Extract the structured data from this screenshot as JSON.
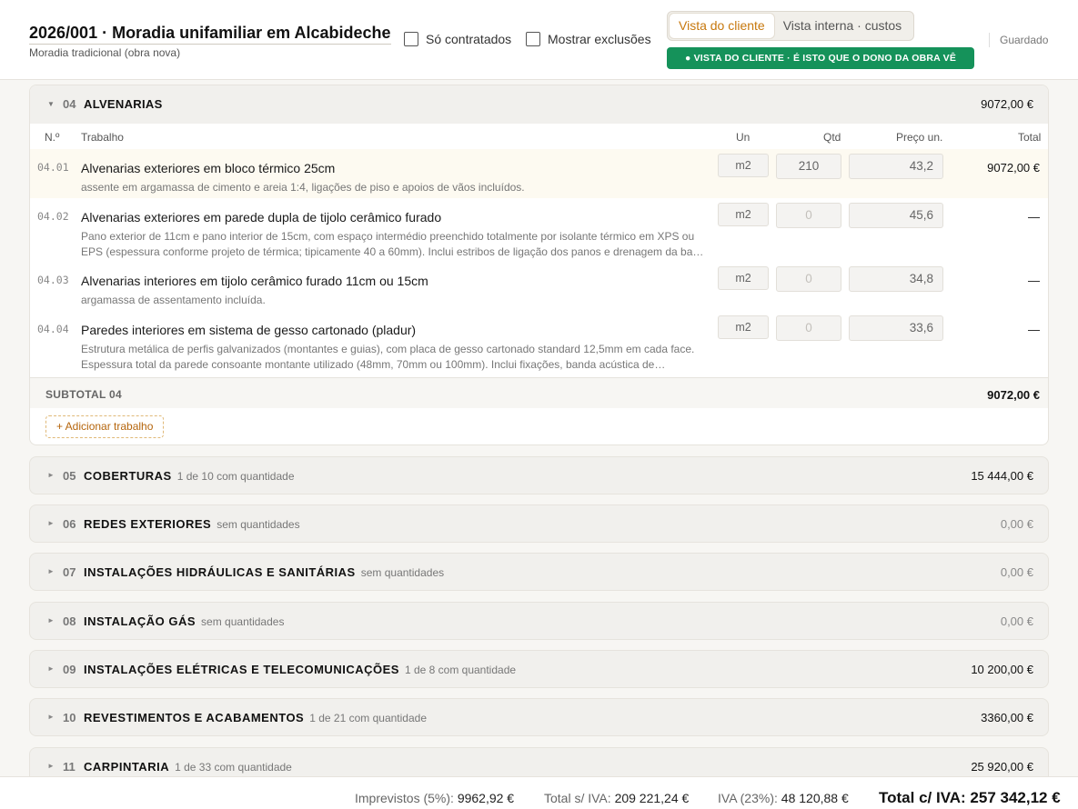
{
  "header": {
    "title": "2026/001 · Moradia unifamiliar em Alcabideche",
    "subtitle": "Moradia tradicional (obra nova)",
    "filters": {
      "contracted_label": "Só contratados",
      "exclusions_label": "Mostrar exclusões"
    },
    "view_toggle": {
      "client": "Vista do cliente",
      "internal": "Vista interna · custos",
      "active": "client"
    },
    "badge": "● VISTA DO CLIENTE · É ISTO QUE O DONO DA OBRA VÊ",
    "status": "Guardado",
    "badge_color": "#15925a",
    "accent_color": "#c7780d"
  },
  "section": {
    "number": "04",
    "name": "ALVENARIAS",
    "total": "9072,00 €",
    "columns": {
      "num": "N.º",
      "work": "Trabalho",
      "unit": "Un",
      "qty": "Qtd",
      "price": "Preço un.",
      "total": "Total"
    },
    "rows": [
      {
        "idx": "04.01",
        "title": "Alvenarias exteriores em bloco térmico 25cm",
        "desc": "assente em argamassa de cimento e areia 1:4, ligações de piso e apoios de vãos incluídos.",
        "unit": "m2",
        "qty": "210",
        "price": "43,2",
        "total": "9072,00 €"
      },
      {
        "idx": "04.02",
        "title": "Alvenarias exteriores em parede dupla de tijolo cerâmico furado",
        "desc": "Pano exterior de 11cm e pano interior de 15cm, com espaço intermédio preenchido totalmente por isolante térmico em XPS ou EPS (espessura conforme projeto de térmica; tipicamente 40 a 60mm). Inclui estribos de ligação dos panos e drenagem da ba…",
        "unit": "m2",
        "qty": "0",
        "price": "45,6",
        "total": "—"
      },
      {
        "idx": "04.03",
        "title": "Alvenarias interiores em tijolo cerâmico furado 11cm ou 15cm",
        "desc": "argamassa de assentamento incluída.",
        "unit": "m2",
        "qty": "0",
        "price": "34,8",
        "total": "—"
      },
      {
        "idx": "04.04",
        "title": "Paredes interiores em sistema de gesso cartonado (pladur)",
        "desc": "Estrutura metálica de perfis galvanizados (montantes e guias), com placa de gesso cartonado standard 12,5mm em cada face. Espessura total da parede consoante montante utilizado (48mm, 70mm ou 100mm). Inclui fixações, banda acústica de…",
        "unit": "m2",
        "qty": "0",
        "price": "33,6",
        "total": "—"
      }
    ],
    "subtotal_label": "SUBTOTAL 04",
    "subtotal_value": "9072,00 €",
    "add_label": "+ Adicionar trabalho"
  },
  "sections": [
    {
      "number": "05",
      "name": "COBERTURAS",
      "note": "1 de 10 com quantidade",
      "total": "15 444,00 €"
    },
    {
      "number": "06",
      "name": "REDES EXTERIORES",
      "note": "sem quantidades",
      "total": "0,00 €"
    },
    {
      "number": "07",
      "name": "INSTALAÇÕES HIDRÁULICAS E SANITÁRIAS",
      "note": "sem quantidades",
      "total": "0,00 €"
    },
    {
      "number": "08",
      "name": "INSTALAÇÃO GÁS",
      "note": "sem quantidades",
      "total": "0,00 €"
    },
    {
      "number": "09",
      "name": "INSTALAÇÕES ELÉTRICAS E TELECOMUNICAÇÕES",
      "note": "1 de 8 com quantidade",
      "total": "10 200,00 €"
    },
    {
      "number": "10",
      "name": "REVESTIMENTOS E ACABAMENTOS",
      "note": "1 de 21 com quantidade",
      "total": "3360,00 €"
    },
    {
      "number": "11",
      "name": "CARPINTARIA",
      "note": "1 de 33 com quantidade",
      "total": "25 920,00 €"
    }
  ],
  "footer": {
    "contingency_label": "Imprevistos (5%):",
    "contingency_value": "9962,92 €",
    "net_label": "Total s/ IVA:",
    "net_value": "209 221,24 €",
    "vat_label": "IVA (23%):",
    "vat_value": "48 120,88 €",
    "grand_total": "Total c/ IVA: 257 342,12 €"
  }
}
